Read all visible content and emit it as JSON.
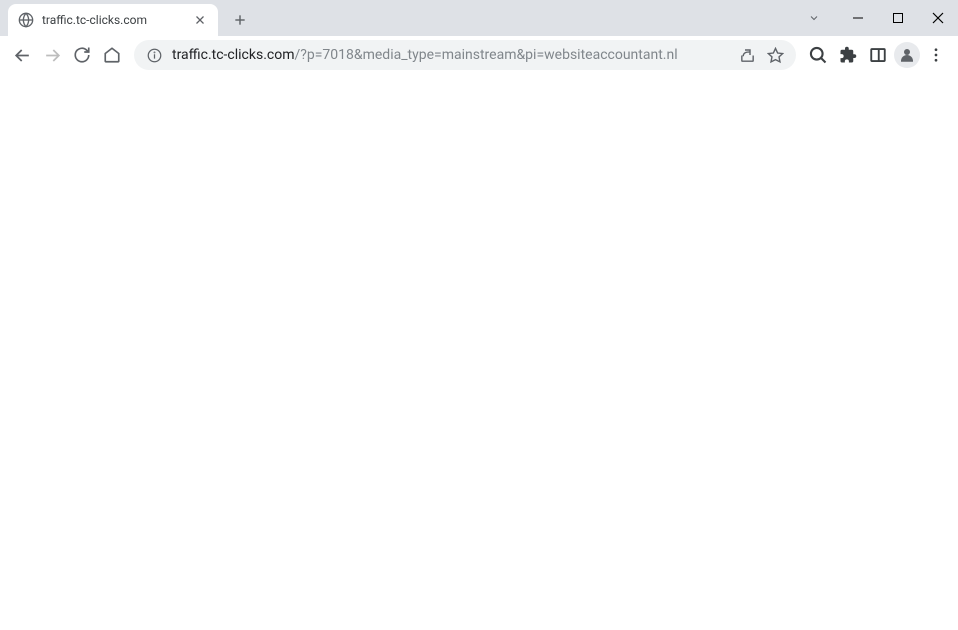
{
  "tab": {
    "title": "traffic.tc-clicks.com"
  },
  "url": {
    "domain": "traffic.tc-clicks.com",
    "path": "/?p=7018&media_type=mainstream&pi=websiteaccountant.nl"
  }
}
